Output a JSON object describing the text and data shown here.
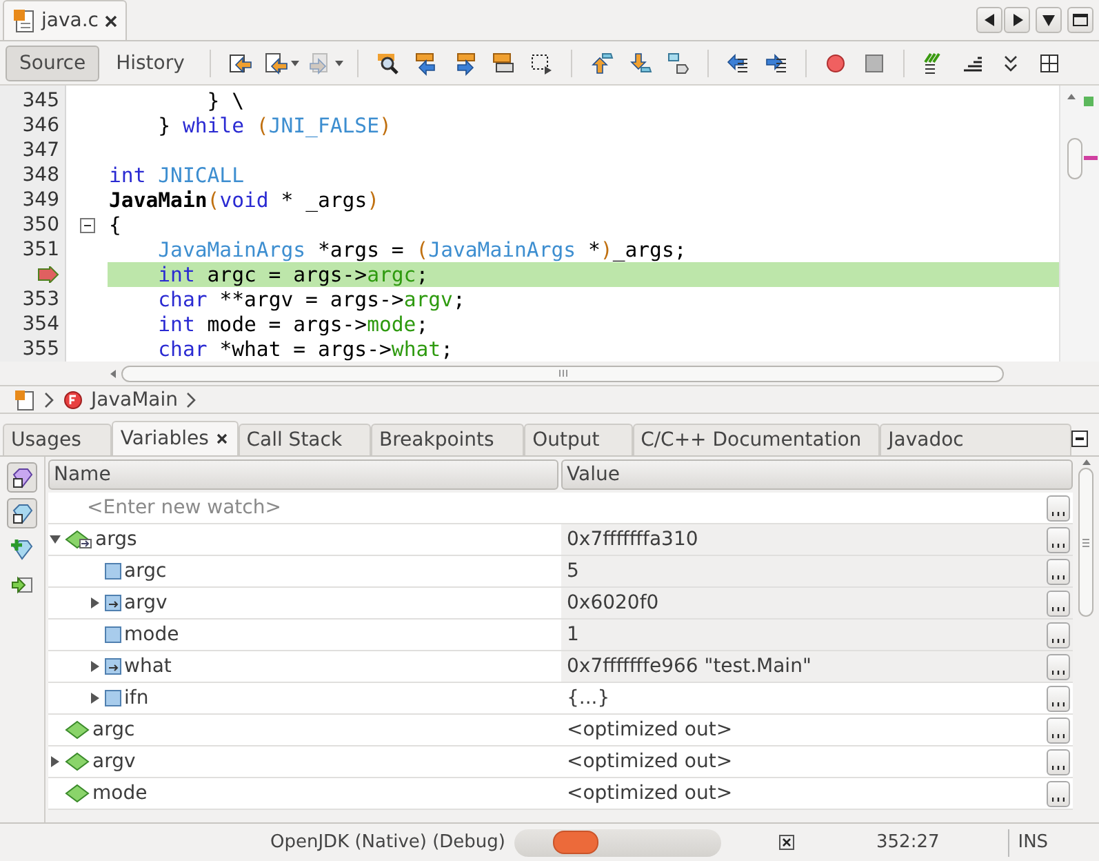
{
  "editor_tabs": [
    {
      "label": "java.c",
      "selected": true
    }
  ],
  "view_tabs": [
    {
      "label": "Source",
      "selected": true
    },
    {
      "label": "History",
      "selected": false
    }
  ],
  "code_lines": [
    {
      "number": "345",
      "current": false,
      "fold": false,
      "tokens": [
        {
          "kind": "plain",
          "text": "        } \\"
        }
      ]
    },
    {
      "number": "346",
      "current": false,
      "fold": false,
      "tokens": [
        {
          "kind": "plain",
          "text": "    } "
        },
        {
          "kind": "keyword",
          "text": "while "
        },
        {
          "kind": "paren",
          "text": "("
        },
        {
          "kind": "ident",
          "text": "JNI_FALSE"
        },
        {
          "kind": "paren",
          "text": ")"
        }
      ]
    },
    {
      "number": "347",
      "current": false,
      "fold": false
    },
    {
      "number": "348",
      "current": false,
      "fold": false,
      "tokens": [
        {
          "kind": "keyword",
          "text": "int "
        },
        {
          "kind": "ident",
          "text": "JNICALL"
        }
      ]
    },
    {
      "number": "349",
      "current": false,
      "fold": false,
      "tokens": [
        {
          "kind": "function",
          "text": "JavaMain"
        },
        {
          "kind": "paren",
          "text": "("
        },
        {
          "kind": "keyword",
          "text": "void"
        },
        {
          "kind": "plain",
          "text": " * _args"
        },
        {
          "kind": "paren",
          "text": ")"
        }
      ]
    },
    {
      "number": "350",
      "current": false,
      "fold": true,
      "tokens": [
        {
          "kind": "plain",
          "text": "{"
        }
      ]
    },
    {
      "number": "351",
      "current": false,
      "fold": false,
      "tokens": [
        {
          "kind": "ident",
          "text": "    JavaMainArgs"
        },
        {
          "kind": "plain",
          "text": " *args = "
        },
        {
          "kind": "paren",
          "text": "("
        },
        {
          "kind": "ident",
          "text": "JavaMainArgs"
        },
        {
          "kind": "plain",
          "text": " *"
        },
        {
          "kind": "paren",
          "text": ")"
        },
        {
          "kind": "plain",
          "text": "_args;"
        }
      ]
    },
    {
      "current": true,
      "fold": false,
      "tokens": [
        {
          "kind": "keyword",
          "text": "    int"
        },
        {
          "kind": "plain",
          "text": " argc = args->"
        },
        {
          "kind": "field",
          "text": "argc"
        },
        {
          "kind": "plain",
          "text": ";"
        }
      ]
    },
    {
      "number": "353",
      "current": false,
      "fold": false,
      "tokens": [
        {
          "kind": "keyword",
          "text": "    char"
        },
        {
          "kind": "plain",
          "text": " **argv = args->"
        },
        {
          "kind": "field",
          "text": "argv"
        },
        {
          "kind": "plain",
          "text": ";"
        }
      ]
    },
    {
      "number": "354",
      "current": false,
      "fold": false,
      "tokens": [
        {
          "kind": "keyword",
          "text": "    int"
        },
        {
          "kind": "plain",
          "text": " mode = args->"
        },
        {
          "kind": "field",
          "text": "mode"
        },
        {
          "kind": "plain",
          "text": ";"
        }
      ]
    },
    {
      "number": "355",
      "current": false,
      "fold": false,
      "tokens": [
        {
          "kind": "keyword",
          "text": "    char"
        },
        {
          "kind": "plain",
          "text": " *what = args->"
        },
        {
          "kind": "field",
          "text": "what"
        },
        {
          "kind": "plain",
          "text": ";"
        }
      ]
    }
  ],
  "breadcrumb": [
    {
      "label": "JavaMain"
    }
  ],
  "panel_tabs": [
    {
      "label": "Usages",
      "selected": false
    },
    {
      "label": "Variables",
      "selected": true
    },
    {
      "label": "Call Stack",
      "selected": false
    },
    {
      "label": "Breakpoints",
      "selected": false
    },
    {
      "label": "Output",
      "selected": false
    },
    {
      "label": "C/C++ Documentation",
      "selected": false
    },
    {
      "label": "Javadoc",
      "selected": false
    }
  ],
  "variables": {
    "columns": [
      "Name",
      "Value"
    ],
    "new_watch": {
      "placeholder": "<Enter new watch>"
    },
    "rows": [
      {
        "name": "args",
        "value": "0x7fffffffa310",
        "kind": "pointer-local",
        "expandable": true,
        "expanded": true,
        "shaded": true,
        "children": [
          {
            "name": "argc",
            "value": "5",
            "kind": "field",
            "expandable": false,
            "shaded": true
          },
          {
            "name": "argv",
            "value": "0x6020f0",
            "kind": "pointer-field",
            "expandable": true,
            "expanded": false,
            "shaded": true
          },
          {
            "name": "mode",
            "value": "1",
            "kind": "field",
            "expandable": false,
            "shaded": true
          },
          {
            "name": "what",
            "value": "0x7fffffffe966 \"test.Main\"",
            "kind": "pointer-field",
            "expandable": true,
            "expanded": false,
            "shaded": true
          },
          {
            "name": "ifn",
            "value": "{...}",
            "kind": "field",
            "expandable": true,
            "expanded": false,
            "shaded": false
          }
        ]
      },
      {
        "name": "argc",
        "value": "<optimized out>",
        "kind": "local",
        "expandable": false,
        "shaded": false
      },
      {
        "name": "argv",
        "value": "<optimized out>",
        "kind": "local",
        "expandable": true,
        "expanded": false,
        "shaded": false
      },
      {
        "name": "mode",
        "value": "<optimized out>",
        "kind": "local",
        "expandable": false,
        "shaded": false
      }
    ]
  },
  "status_bar": {
    "session": "OpenJDK (Native) (Debug)",
    "position": "352:27",
    "mode": "INS"
  }
}
